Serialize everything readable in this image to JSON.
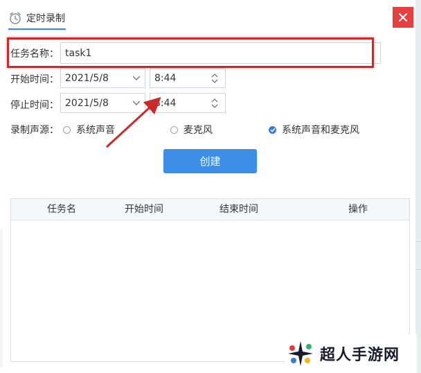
{
  "dialog": {
    "tab_title": "定时录制",
    "close_glyph": "✕"
  },
  "form": {
    "task_name_label": "任务名称：",
    "task_name_value": "task1",
    "start_label": "开始时间：",
    "start_date": "2021/5/8",
    "start_time": "8:44",
    "stop_label": "停止时间：",
    "stop_date": "2021/5/8",
    "stop_time": "8:44",
    "source_label": "录制声源：",
    "sources": [
      {
        "label": "系统声音",
        "checked": false
      },
      {
        "label": "麦克风",
        "checked": false
      },
      {
        "label": "系统声音和麦克风",
        "checked": true
      }
    ],
    "create_label": "创建"
  },
  "table": {
    "headers": [
      "任务名",
      "开始时间",
      "结束时间",
      "操作"
    ]
  },
  "watermark": {
    "text": "超人手游网"
  },
  "colors": {
    "accent": "#3d8ee6",
    "close": "#e64141",
    "highlight": "#c92a2a"
  },
  "icons": {
    "tab": "clock-icon",
    "close": "close-icon",
    "dropdown": "chevron-down-icon",
    "spinner": "spinner-arrows-icon",
    "watermark": "sparkle-logo-icon"
  }
}
